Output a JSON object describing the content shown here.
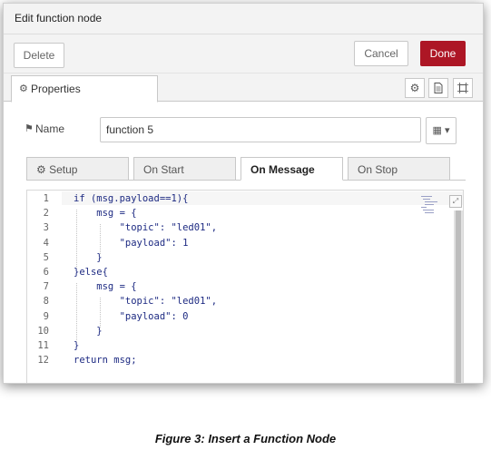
{
  "dialog": {
    "title": "Edit function node",
    "delete_label": "Delete",
    "cancel_label": "Cancel",
    "done_label": "Done",
    "accent": "#ad1625"
  },
  "tabs": {
    "properties_label": "Properties",
    "properties_icon": "gear-icon",
    "tool_icons": [
      "gear-icon",
      "document-icon",
      "frame-icon"
    ]
  },
  "name_field": {
    "label": "Name",
    "icon": "tag-icon",
    "value": "function 5",
    "menu_icon": "book-dropdown-icon"
  },
  "subtabs": [
    {
      "label": "Setup",
      "icon": "gear-icon",
      "active": false
    },
    {
      "label": "On Start",
      "active": false
    },
    {
      "label": "On Message",
      "active": true
    },
    {
      "label": "On Stop",
      "active": false
    }
  ],
  "code_lines": [
    {
      "n": "1",
      "text": "if (msg.payload==1){"
    },
    {
      "n": "2",
      "text": "    msg = {"
    },
    {
      "n": "3",
      "text": "        \"topic\": \"led01\","
    },
    {
      "n": "4",
      "text": "        \"payload\": 1"
    },
    {
      "n": "5",
      "text": "    }"
    },
    {
      "n": "6",
      "text": "}else{"
    },
    {
      "n": "7",
      "text": "    msg = {"
    },
    {
      "n": "8",
      "text": "        \"topic\": \"led01\","
    },
    {
      "n": "9",
      "text": "        \"payload\": 0"
    },
    {
      "n": "10",
      "text": "    }"
    },
    {
      "n": "11",
      "text": "}"
    },
    {
      "n": "12",
      "text": "return msg;"
    }
  ],
  "caption": "Figure 3: Insert a Function Node"
}
